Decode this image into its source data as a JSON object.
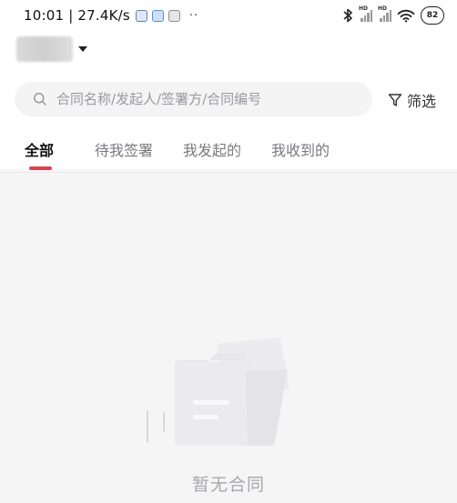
{
  "status_bar": {
    "time_speed": "10:01 | 27.4K/s",
    "dots": "··",
    "signal_label": "HD",
    "battery": "82"
  },
  "search": {
    "placeholder": "合同名称/发起人/签署方/合同编号",
    "value": ""
  },
  "filter": {
    "label": "筛选"
  },
  "tabs": [
    {
      "label": "全部",
      "active": true
    },
    {
      "label": "待我签署",
      "active": false
    },
    {
      "label": "我发起的",
      "active": false
    },
    {
      "label": "我收到的",
      "active": false
    }
  ],
  "empty_state": {
    "text": "暂无合同"
  },
  "colors": {
    "accent": "#e3404f",
    "background": "#f5f5f6",
    "header": "#ffffff",
    "muted_text": "#a7a7ab"
  }
}
